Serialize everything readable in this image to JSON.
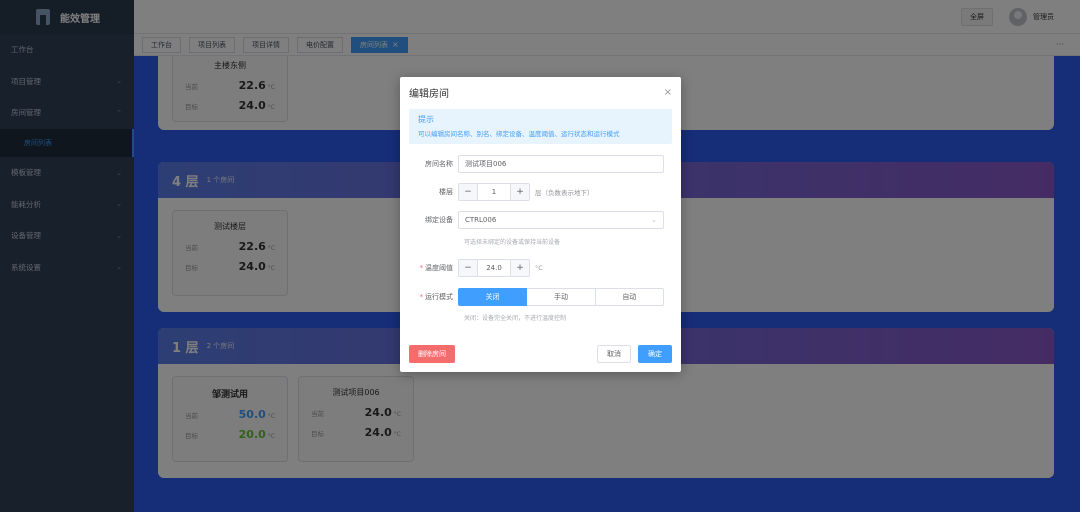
{
  "app": {
    "title": "能效管理"
  },
  "header": {
    "fullscreen_label": "全屏",
    "user_name": "管理员"
  },
  "sidebar": {
    "items": [
      {
        "label": "工作台"
      },
      {
        "label": "项目管理"
      },
      {
        "label": "房间管理"
      },
      {
        "label": "房间列表"
      },
      {
        "label": "模板管理"
      },
      {
        "label": "能耗分析"
      },
      {
        "label": "设备管理"
      },
      {
        "label": "系统设置"
      }
    ]
  },
  "tabs": [
    {
      "label": "工作台"
    },
    {
      "label": "项目列表"
    },
    {
      "label": "项目详情"
    },
    {
      "label": "电价配置"
    },
    {
      "label": "房间列表"
    }
  ],
  "tabs_more": "···",
  "floors": [
    {
      "rooms": [
        {
          "name": "主楼东侧",
          "current_label": "当前",
          "current": "22.6",
          "target_label": "目标",
          "target": "24.0",
          "unit": "°C"
        }
      ]
    },
    {
      "name": "4 层",
      "count": "1 个房间",
      "rooms": [
        {
          "name": "测试楼层",
          "current_label": "当前",
          "current": "22.6",
          "target_label": "目标",
          "target": "24.0",
          "unit": "°C"
        }
      ]
    },
    {
      "name": "1 层",
      "count": "2 个房间",
      "rooms": [
        {
          "name": "邹测试用",
          "current_label": "当前",
          "current": "50.0",
          "target_label": "目标",
          "target": "20.0",
          "unit": "°C"
        },
        {
          "name": "测试项目006",
          "current_label": "当前",
          "current": "24.0",
          "target_label": "目标",
          "target": "24.0",
          "unit": "°C"
        }
      ]
    }
  ],
  "dialog": {
    "title": "编辑房间",
    "close": "×",
    "tip_title": "提示",
    "tip_text": "可以编辑房间名称、别名、绑定设备、温度阈值、运行状态和运行模式",
    "room_name_label": "房间名称",
    "room_name_value": "测试项目006",
    "floor_label": "楼层",
    "floor_value": "1",
    "floor_hint": "层（负数表示地下）",
    "device_label": "绑定设备",
    "device_value": "CTRL006",
    "device_hint": "可选择未绑定的设备或保持当前设备",
    "temp_label": "温度阈值",
    "temp_value": "24.0",
    "temp_unit": "°C",
    "mode_label": "运行模式",
    "mode_options": [
      "关闭",
      "手动",
      "自动"
    ],
    "mode_selected": "关闭",
    "mode_hint": "关闭：设备完全关闭，不进行温度控制",
    "minus": "−",
    "plus": "+",
    "delete_label": "删除房间",
    "cancel_label": "取消",
    "ok_label": "确定",
    "required_mark": "*"
  }
}
